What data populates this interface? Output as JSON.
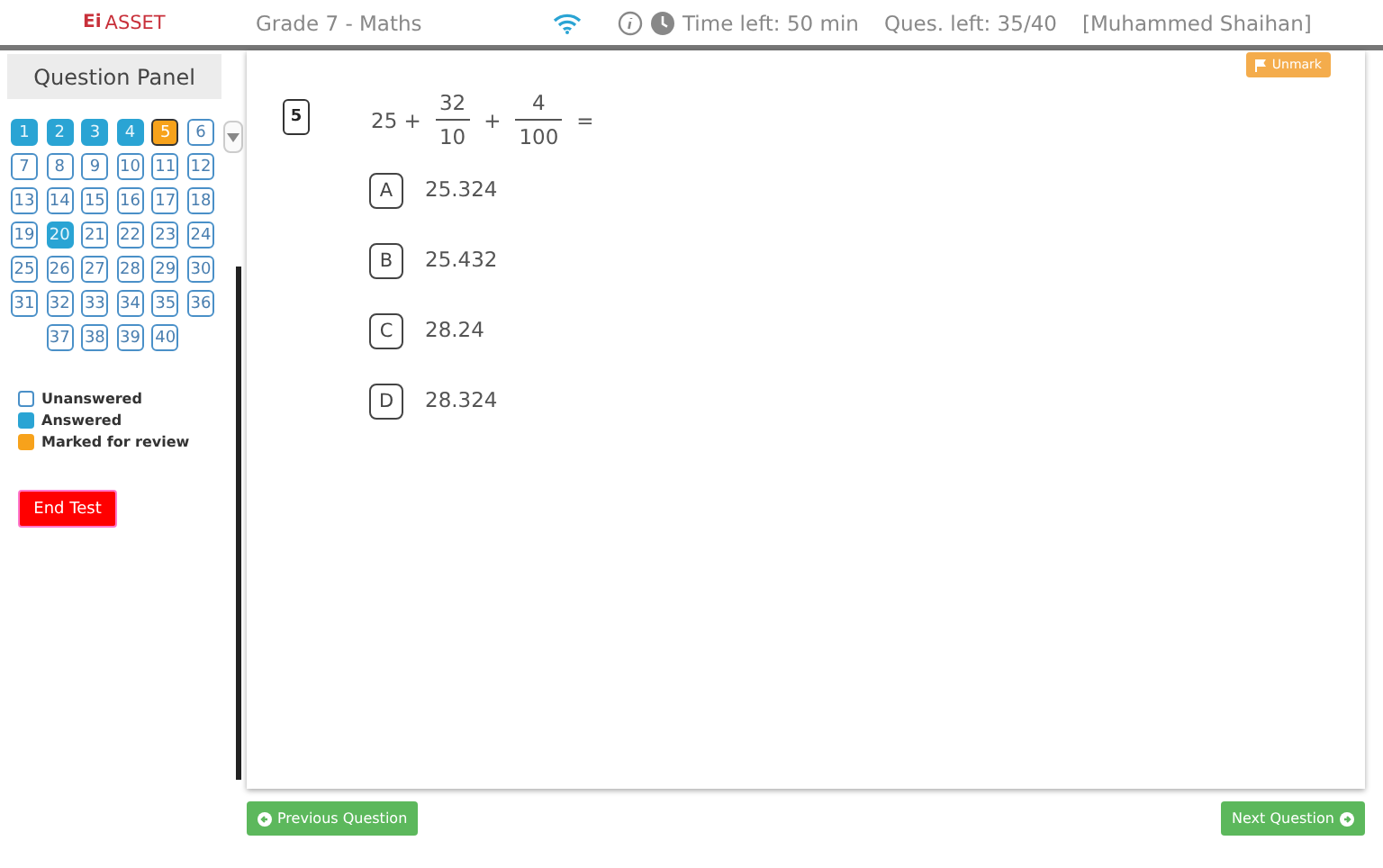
{
  "header": {
    "logo_mark": "Ei",
    "logo_text": "ASSET",
    "subject": "Grade 7 - Maths",
    "time_left": "Time left: 50 min",
    "questions_left": "Ques. left: 35/40",
    "user": "[Muhammed Shaihan]"
  },
  "panel": {
    "title": "Question Panel",
    "questions": [
      {
        "label": "1",
        "kind": "answered",
        "selected": false
      },
      {
        "label": "2",
        "kind": "answered",
        "selected": false
      },
      {
        "label": "3",
        "kind": "answered",
        "selected": false
      },
      {
        "label": "4",
        "kind": "answered",
        "selected": false
      },
      {
        "label": "5",
        "kind": "marked",
        "selected": true
      },
      {
        "label": "6",
        "kind": "unanswered",
        "selected": false
      },
      {
        "label": "7",
        "kind": "unanswered",
        "selected": false
      },
      {
        "label": "8",
        "kind": "unanswered",
        "selected": false
      },
      {
        "label": "9",
        "kind": "unanswered",
        "selected": false
      },
      {
        "label": "10",
        "kind": "unanswered",
        "selected": false
      },
      {
        "label": "11",
        "kind": "unanswered",
        "selected": false
      },
      {
        "label": "12",
        "kind": "unanswered",
        "selected": false
      },
      {
        "label": "13",
        "kind": "unanswered",
        "selected": false
      },
      {
        "label": "14",
        "kind": "unanswered",
        "selected": false
      },
      {
        "label": "15",
        "kind": "unanswered",
        "selected": false
      },
      {
        "label": "16",
        "kind": "unanswered",
        "selected": false
      },
      {
        "label": "17",
        "kind": "unanswered",
        "selected": false
      },
      {
        "label": "18",
        "kind": "unanswered",
        "selected": false
      },
      {
        "label": "19",
        "kind": "unanswered",
        "selected": false
      },
      {
        "label": "20",
        "kind": "answered",
        "selected": false
      },
      {
        "label": "21",
        "kind": "unanswered",
        "selected": false
      },
      {
        "label": "22",
        "kind": "unanswered",
        "selected": false
      },
      {
        "label": "23",
        "kind": "unanswered",
        "selected": false
      },
      {
        "label": "24",
        "kind": "unanswered",
        "selected": false
      },
      {
        "label": "25",
        "kind": "unanswered",
        "selected": false
      },
      {
        "label": "26",
        "kind": "unanswered",
        "selected": false
      },
      {
        "label": "27",
        "kind": "unanswered",
        "selected": false
      },
      {
        "label": "28",
        "kind": "unanswered",
        "selected": false
      },
      {
        "label": "29",
        "kind": "unanswered",
        "selected": false
      },
      {
        "label": "30",
        "kind": "unanswered",
        "selected": false
      },
      {
        "label": "31",
        "kind": "unanswered",
        "selected": false
      },
      {
        "label": "32",
        "kind": "unanswered",
        "selected": false
      },
      {
        "label": "33",
        "kind": "unanswered",
        "selected": false
      },
      {
        "label": "34",
        "kind": "unanswered",
        "selected": false
      },
      {
        "label": "35",
        "kind": "unanswered",
        "selected": false
      },
      {
        "label": "36",
        "kind": "unanswered",
        "selected": false
      },
      {
        "label": "37",
        "kind": "unanswered",
        "selected": false
      },
      {
        "label": "38",
        "kind": "unanswered",
        "selected": false
      },
      {
        "label": "39",
        "kind": "unanswered",
        "selected": false
      },
      {
        "label": "40",
        "kind": "unanswered",
        "selected": false
      }
    ],
    "legend": [
      {
        "kind": "unanswered",
        "label": "Unanswered"
      },
      {
        "kind": "answered",
        "label": "Answered"
      },
      {
        "kind": "marked",
        "label": "Marked for review"
      }
    ],
    "end_button": "End Test"
  },
  "question": {
    "mark_button": "Unmark",
    "number": "5",
    "expression": [
      {
        "kind": "text",
        "text": "25 +"
      },
      {
        "kind": "fraction",
        "numerator": "32",
        "denominator": "10"
      },
      {
        "kind": "text",
        "text": "+"
      },
      {
        "kind": "fraction",
        "numerator": "4",
        "denominator": "100"
      },
      {
        "kind": "text",
        "text": "="
      }
    ],
    "options": [
      {
        "letter": "A",
        "text": "25.324"
      },
      {
        "letter": "B",
        "text": "25.432"
      },
      {
        "letter": "C",
        "text": "28.24"
      },
      {
        "letter": "D",
        "text": "28.324"
      }
    ]
  },
  "nav": {
    "previous": "Previous Question",
    "next": "Next Question"
  }
}
